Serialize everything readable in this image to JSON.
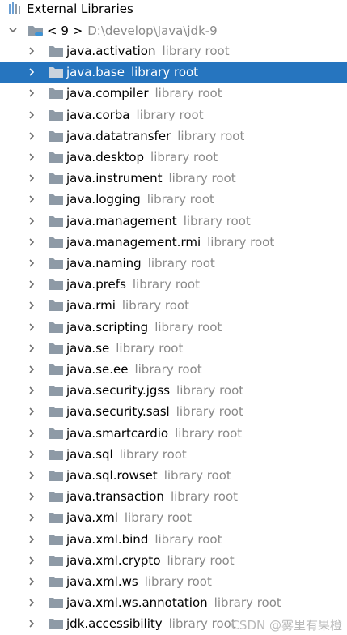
{
  "header": {
    "title": "External Libraries"
  },
  "sdk": {
    "name": "< 9 >",
    "path": "D:\\develop\\Java\\jdk-9"
  },
  "library_hint": "library root",
  "colors": {
    "selection": "#2675bf",
    "hint": "#8a8a8a",
    "folder": "#8e9aa6"
  },
  "selected_index": 1,
  "items": [
    {
      "label": "java.activation"
    },
    {
      "label": "java.base"
    },
    {
      "label": "java.compiler"
    },
    {
      "label": "java.corba"
    },
    {
      "label": "java.datatransfer"
    },
    {
      "label": "java.desktop"
    },
    {
      "label": "java.instrument"
    },
    {
      "label": "java.logging"
    },
    {
      "label": "java.management"
    },
    {
      "label": "java.management.rmi"
    },
    {
      "label": "java.naming"
    },
    {
      "label": "java.prefs"
    },
    {
      "label": "java.rmi"
    },
    {
      "label": "java.scripting"
    },
    {
      "label": "java.se"
    },
    {
      "label": "java.se.ee"
    },
    {
      "label": "java.security.jgss"
    },
    {
      "label": "java.security.sasl"
    },
    {
      "label": "java.smartcardio"
    },
    {
      "label": "java.sql"
    },
    {
      "label": "java.sql.rowset"
    },
    {
      "label": "java.transaction"
    },
    {
      "label": "java.xml"
    },
    {
      "label": "java.xml.bind"
    },
    {
      "label": "java.xml.crypto"
    },
    {
      "label": "java.xml.ws"
    },
    {
      "label": "java.xml.ws.annotation"
    },
    {
      "label": "jdk.accessibility"
    }
  ],
  "watermark": "CSDN @雾里有果橙"
}
